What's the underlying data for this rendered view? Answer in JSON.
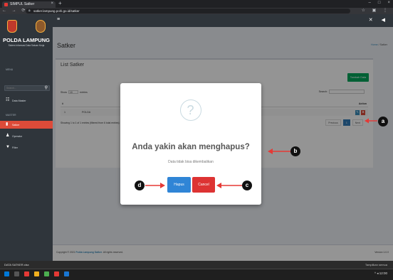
{
  "browser": {
    "tab_title": "SIMPUL Satker",
    "tab_close": "×",
    "new_tab": "+",
    "window_controls": [
      "–",
      "□",
      "×"
    ],
    "nav": "← → ⟳",
    "url": "satker.lampung.polri.go.id/satker",
    "bar_icons": "☆ ▣ ⋮"
  },
  "sidebar": {
    "brand": "POLDA LAMPUNG",
    "brand_sub": "Sistem Informasi Data Satuan Kerja",
    "header_main": "MENU",
    "search_placeholder": "Search...",
    "search_icon": "⚲",
    "header_master": "MASTER",
    "items": [
      {
        "label": "Data Master",
        "icon": "☷"
      },
      {
        "label": "Satker",
        "icon": "▮"
      },
      {
        "label": "Operator",
        "icon": "♟"
      },
      {
        "label": "Filter",
        "icon": "▼"
      }
    ]
  },
  "topbar": {
    "menu_icon": "≡",
    "icons": "✕ ◀"
  },
  "page": {
    "title": "Satker",
    "breadcrumb_home": "Home",
    "breadcrumb_sep": " / ",
    "breadcrumb_current": "Satker"
  },
  "box": {
    "title": "List Satker",
    "add_button": "Tambah Data",
    "show_label": "Show",
    "show_value": "10",
    "entries_label": "entries",
    "search_label": "Search:",
    "col_no": "#",
    "col_action": "Action",
    "row": {
      "no": "1",
      "name": "POLDA",
      "edit": "✎",
      "delete": "✖"
    },
    "showing": "Showing 1 to 1 of 1 entries (filtered from 6 total entries)",
    "prev": "Previous",
    "page": "1",
    "next": "Next"
  },
  "footer": {
    "copyright": "Copyright © 2021 ",
    "org": "Polda Lampung Satker",
    "rights": ". All rights reserved.",
    "version": "Version 1.0.0"
  },
  "modal": {
    "icon": "?",
    "title": "Anda yakin akan menghapus?",
    "text": "Data tidak bisa dikembalikan",
    "confirm": "Hapus",
    "cancel": "Cancel"
  },
  "annotations": {
    "a": "a",
    "b": "b",
    "c": "c",
    "d": "d"
  },
  "taskbar": {
    "download": "DATA SATKER.xlsx",
    "download_right": "Tampilkan semua",
    "tray": "^ ◂ 12:00"
  }
}
